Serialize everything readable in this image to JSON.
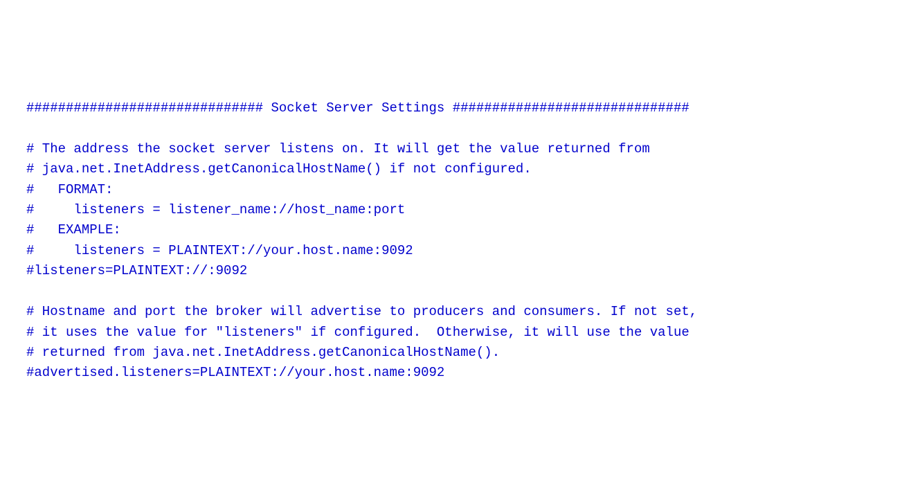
{
  "code": {
    "lines": [
      "############################## Socket Server Settings ##############################",
      "",
      "# The address the socket server listens on. It will get the value returned from ",
      "# java.net.InetAddress.getCanonicalHostName() if not configured.",
      "#   FORMAT:",
      "#     listeners = listener_name://host_name:port",
      "#   EXAMPLE:",
      "#     listeners = PLAINTEXT://your.host.name:9092",
      "#listeners=PLAINTEXT://:9092",
      "",
      "# Hostname and port the broker will advertise to producers and consumers. If not set, ",
      "# it uses the value for \"listeners\" if configured.  Otherwise, it will use the value",
      "# returned from java.net.InetAddress.getCanonicalHostName().",
      "#advertised.listeners=PLAINTEXT://your.host.name:9092"
    ]
  }
}
